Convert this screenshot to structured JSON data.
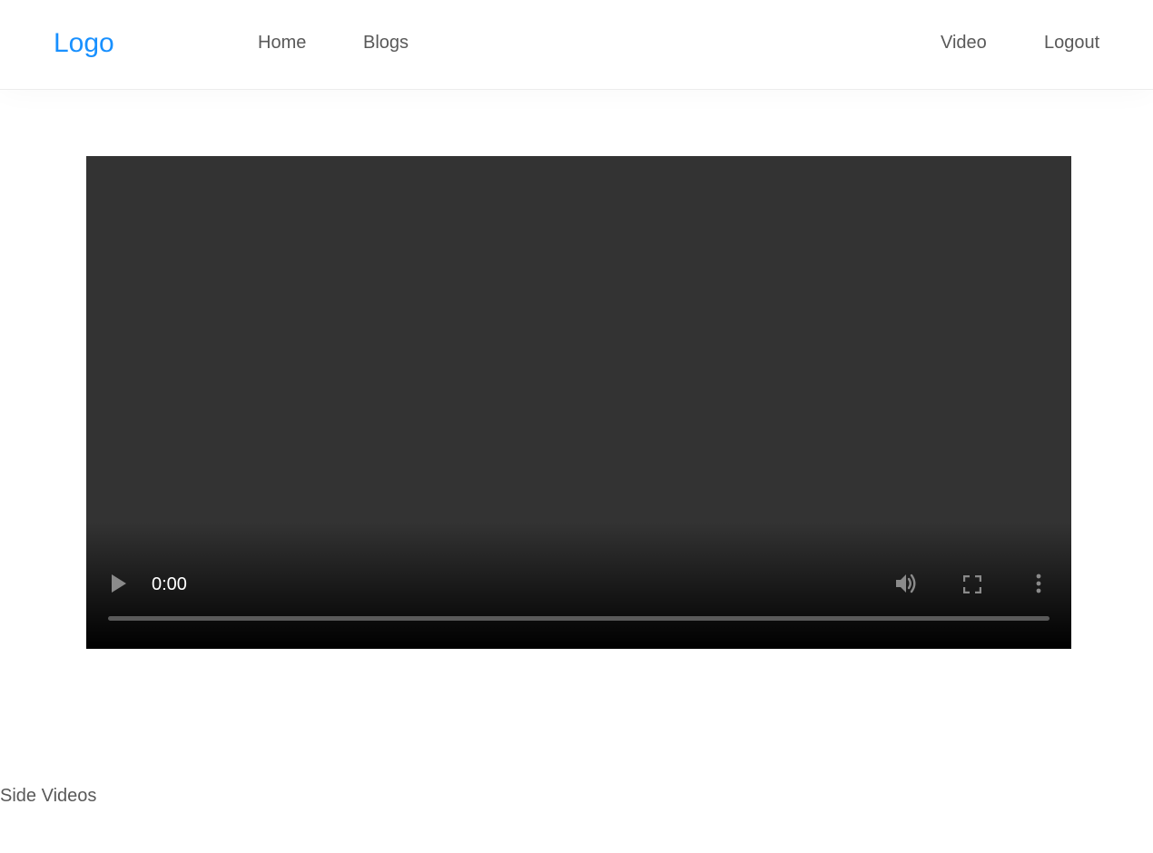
{
  "navbar": {
    "logo": "Logo",
    "links": {
      "home": "Home",
      "blogs": "Blogs",
      "video": "Video",
      "logout": "Logout"
    }
  },
  "video_player": {
    "current_time": "0:00",
    "progress": 0,
    "icons": {
      "play": "play-icon",
      "volume": "volume-icon",
      "fullscreen": "fullscreen-icon",
      "more": "more-vertical-icon"
    }
  },
  "side_videos": {
    "heading": "Side Videos"
  },
  "colors": {
    "logo": "#1890ff",
    "nav_text": "#595959",
    "player_bg": "#333333",
    "player_icon": "#8a8a8a"
  }
}
